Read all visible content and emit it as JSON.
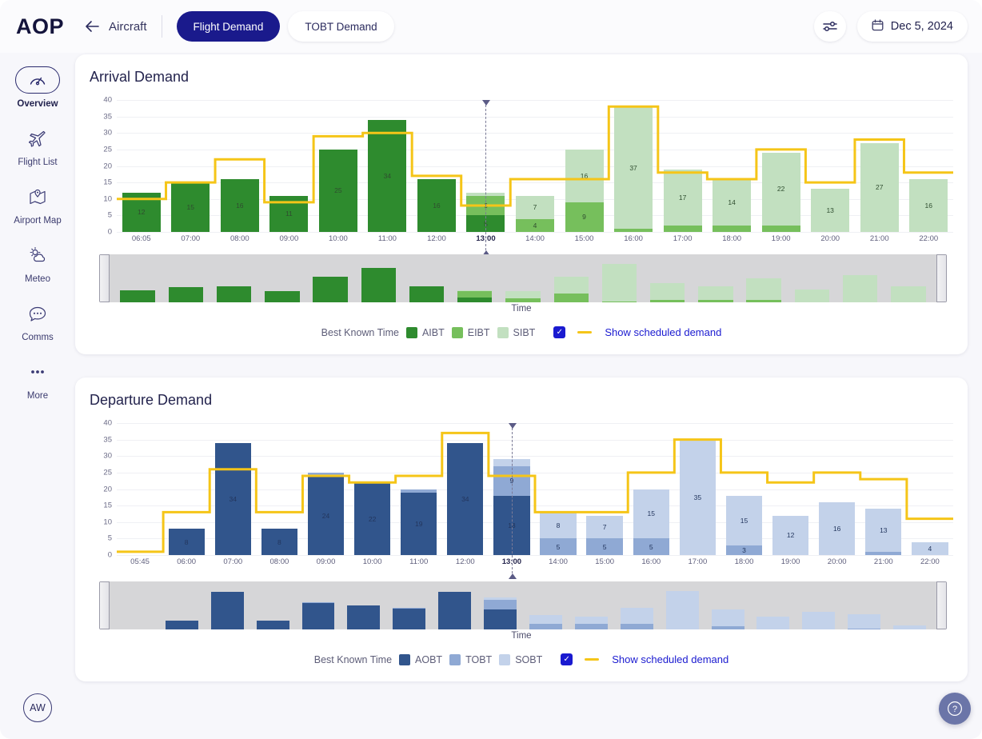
{
  "header": {
    "brand": "AOP",
    "back_icon": "arrow-left-icon",
    "breadcrumb": "Aircraft",
    "tabs": [
      {
        "label": "Flight Demand",
        "active": true
      },
      {
        "label": "TOBT Demand",
        "active": false
      }
    ],
    "filter_icon": "sliders-icon",
    "calendar_icon": "calendar-icon",
    "date": "Dec 5, 2024"
  },
  "sidebar": {
    "items": [
      {
        "label": "Overview",
        "icon": "gauge-icon",
        "active": true
      },
      {
        "label": "Flight List",
        "icon": "airplane-icon",
        "active": false
      },
      {
        "label": "Airport Map",
        "icon": "map-pin-icon",
        "active": false
      },
      {
        "label": "Meteo",
        "icon": "weather-icon",
        "active": false
      },
      {
        "label": "Comms",
        "icon": "chat-icon",
        "active": false
      },
      {
        "label": "More",
        "icon": "ellipsis-icon",
        "active": false
      }
    ],
    "avatar": "AW",
    "help_icon": "question-mark-icon"
  },
  "colors": {
    "accent": "#1a1ad0",
    "scheduled_line": "#f5c518",
    "arrival_aibt": "#2e8b2e",
    "arrival_eibt": "#76bf5c",
    "arrival_sibt": "#c2e0c0",
    "departure_aobt": "#31558c",
    "departure_tobt": "#8fa9d4",
    "departure_sobt": "#c3d2ea",
    "now_marker": "#5b5b86"
  },
  "arrival": {
    "title": "Arrival Demand",
    "time_axis_label": "Time",
    "legend": {
      "prefix": "Best Known Time",
      "series": [
        {
          "label": "AIBT",
          "color": "#2e8b2e"
        },
        {
          "label": "EIBT",
          "color": "#76bf5c"
        },
        {
          "label": "SIBT",
          "color": "#c2e0c0"
        }
      ],
      "checkbox_checked": true,
      "toggle_label": "Show scheduled demand"
    },
    "now_time": "13:00"
  },
  "departure": {
    "title": "Departure Demand",
    "time_axis_label": "Time",
    "legend": {
      "prefix": "Best Known Time",
      "series": [
        {
          "label": "AOBT",
          "color": "#31558c"
        },
        {
          "label": "TOBT",
          "color": "#8fa9d4"
        },
        {
          "label": "SOBT",
          "color": "#c3d2ea"
        }
      ],
      "checkbox_checked": true,
      "toggle_label": "Show scheduled demand"
    },
    "now_time": "13:00"
  },
  "chart_data": [
    {
      "type": "bar",
      "id": "arrival-demand",
      "title": "Arrival Demand",
      "stacked": true,
      "xlabel": "Time",
      "ylabel": "",
      "ylim": [
        0,
        40
      ],
      "yticks": [
        0,
        5,
        10,
        15,
        20,
        25,
        30,
        35,
        40
      ],
      "grid": true,
      "legend_position": "bottom",
      "categories": [
        "06:05",
        "07:00",
        "08:00",
        "09:00",
        "10:00",
        "11:00",
        "12:00",
        "13:00",
        "14:00",
        "15:00",
        "16:00",
        "17:00",
        "18:00",
        "19:00",
        "20:00",
        "21:00",
        "22:00"
      ],
      "series": [
        {
          "name": "AIBT",
          "color": "#2e8b2e",
          "values": [
            12,
            15,
            16,
            11,
            25,
            34,
            16,
            5,
            0,
            0,
            0,
            0,
            0,
            0,
            0,
            0,
            0
          ]
        },
        {
          "name": "EIBT",
          "color": "#76bf5c",
          "values": [
            0,
            0,
            0,
            0,
            0,
            0,
            0,
            6,
            4,
            9,
            1,
            2,
            2,
            2,
            0,
            0,
            0
          ]
        },
        {
          "name": "SIBT",
          "color": "#c2e0c0",
          "values": [
            0,
            0,
            0,
            0,
            0,
            0,
            0,
            1,
            7,
            16,
            37,
            17,
            14,
            22,
            13,
            27,
            16
          ]
        }
      ],
      "scheduled_demand": {
        "name": "Show scheduled demand",
        "color": "#f5c518",
        "values": [
          10,
          15,
          22,
          9,
          29,
          30,
          17,
          8,
          16,
          16,
          38,
          18,
          16,
          25,
          15,
          28,
          18
        ]
      },
      "now_marker": "13:00"
    },
    {
      "type": "bar",
      "id": "departure-demand",
      "title": "Departure Demand",
      "stacked": true,
      "xlabel": "Time",
      "ylabel": "",
      "ylim": [
        0,
        40
      ],
      "yticks": [
        0,
        5,
        10,
        15,
        20,
        25,
        30,
        35,
        40
      ],
      "grid": true,
      "legend_position": "bottom",
      "categories": [
        "05:45",
        "06:00",
        "07:00",
        "08:00",
        "09:00",
        "10:00",
        "11:00",
        "12:00",
        "13:00",
        "14:00",
        "15:00",
        "16:00",
        "17:00",
        "18:00",
        "19:00",
        "20:00",
        "21:00",
        "22:00"
      ],
      "series": [
        {
          "name": "AOBT",
          "color": "#31558c",
          "values": [
            0,
            8,
            34,
            8,
            24,
            22,
            19,
            34,
            18,
            0,
            0,
            0,
            0,
            0,
            0,
            0,
            0,
            0
          ]
        },
        {
          "name": "TOBT",
          "color": "#8fa9d4",
          "values": [
            0,
            0,
            0,
            0,
            1,
            0,
            1,
            0,
            9,
            5,
            5,
            5,
            0,
            3,
            0,
            0,
            1,
            0
          ]
        },
        {
          "name": "SOBT",
          "color": "#c3d2ea",
          "values": [
            0,
            0,
            0,
            0,
            0,
            0,
            0,
            0,
            2,
            8,
            7,
            15,
            35,
            15,
            12,
            16,
            13,
            4
          ]
        }
      ],
      "scheduled_demand": {
        "name": "Show scheduled demand",
        "color": "#f5c518",
        "values": [
          1,
          13,
          26,
          13,
          24,
          22,
          24,
          37,
          24,
          13,
          13,
          25,
          35,
          25,
          22,
          25,
          23,
          11
        ]
      },
      "now_marker": "13:00"
    }
  ]
}
